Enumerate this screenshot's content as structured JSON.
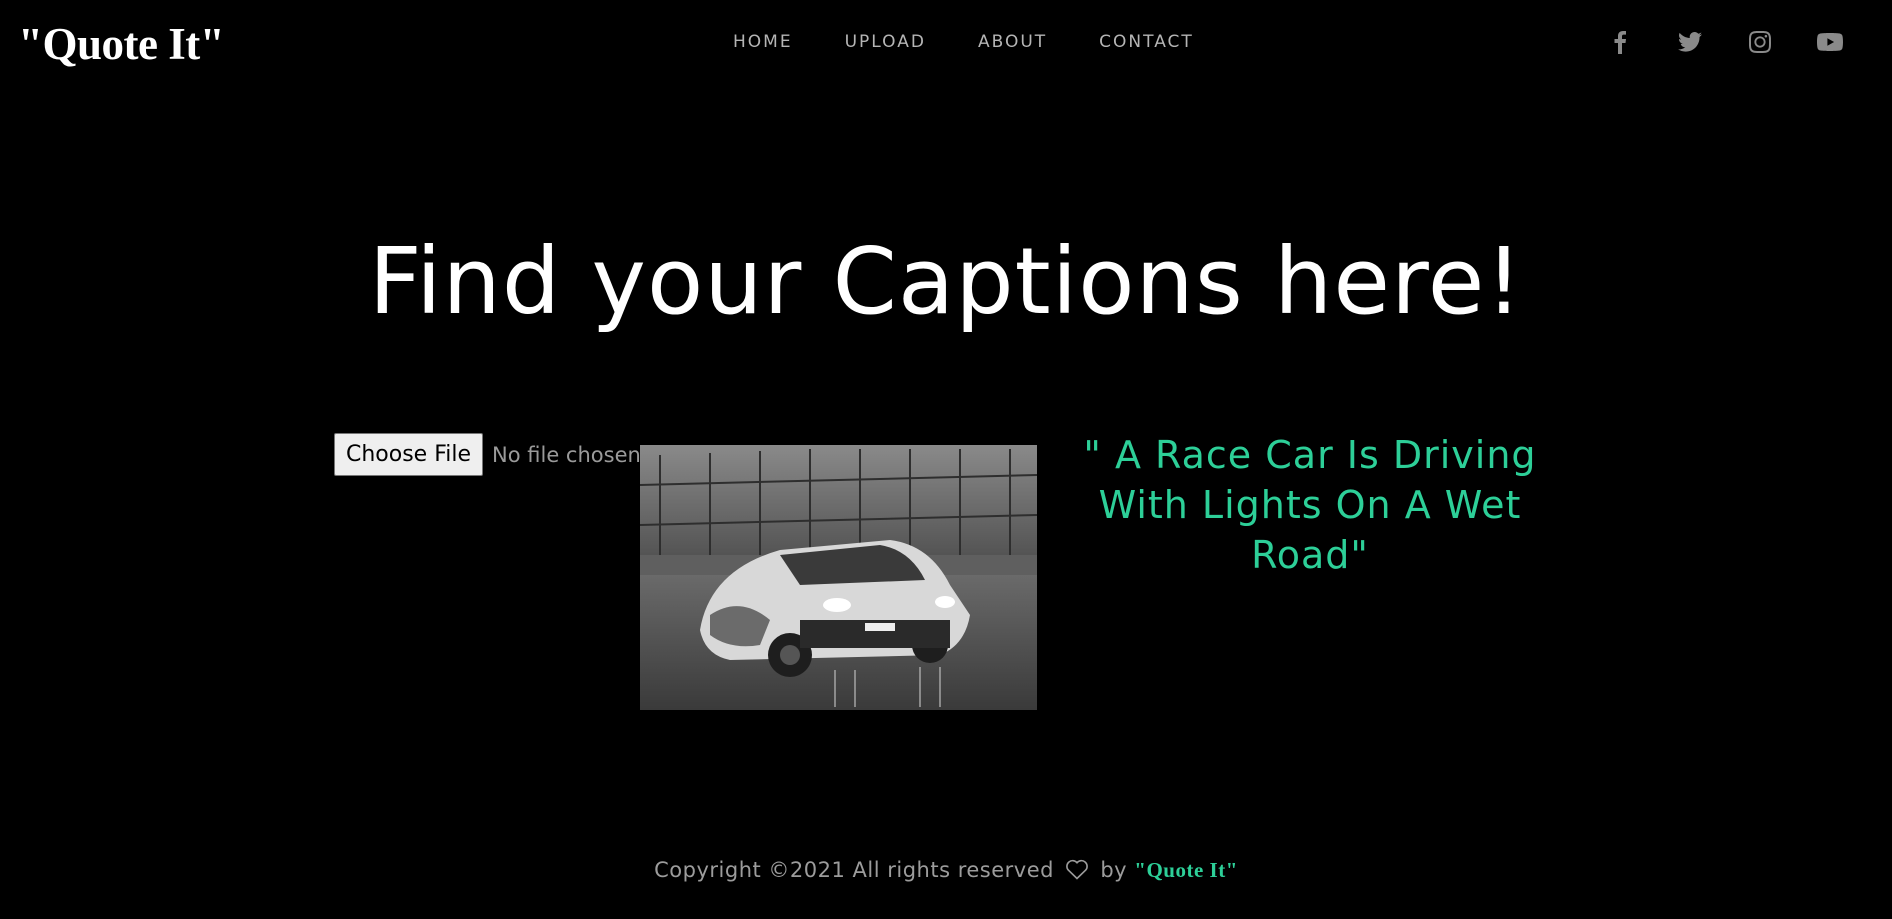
{
  "brand": "\"Quote It\"",
  "nav": [
    {
      "label": "HOME"
    },
    {
      "label": "UPLOAD"
    },
    {
      "label": "ABOUT"
    },
    {
      "label": "CONTACT"
    }
  ],
  "social": [
    "facebook-icon",
    "twitter-icon",
    "instagram-icon",
    "youtube-icon"
  ],
  "hero": {
    "title": "Find your Captions here!"
  },
  "upload": {
    "button_label": "Choose File",
    "status": "No file chosen"
  },
  "result": {
    "image_subject": "race car driving on wet track with headlights on",
    "caption": "\" A Race Car Is Driving With Lights On A Wet Road\""
  },
  "footer": {
    "text": "Copyright ©2021 All rights reserved",
    "by": "by",
    "brand": "\"Quote It\""
  },
  "colors": {
    "accent": "#2dcf98",
    "background": "#000000",
    "nav_text": "#b5b5b5"
  }
}
